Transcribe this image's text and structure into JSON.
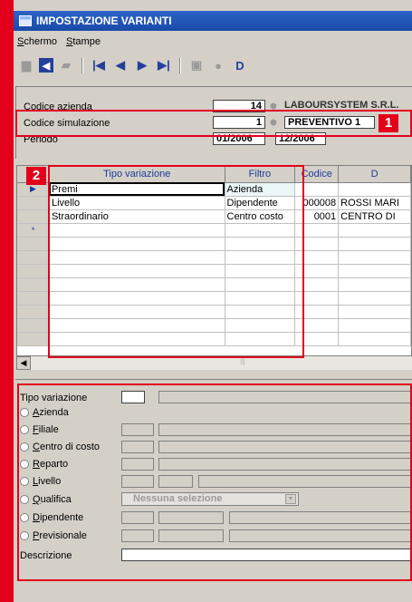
{
  "window": {
    "title": "IMPOSTAZIONE VARIANTI"
  },
  "menu": [
    {
      "label": "Schermo"
    },
    {
      "label": "Stampe"
    }
  ],
  "toolbar": {
    "icons": [
      "save-icon",
      "exit-icon",
      "edit-icon",
      "first-record-icon",
      "previous-record-icon",
      "next-record-icon",
      "last-record-icon",
      "binoculars-icon",
      "search-icon",
      "report-icon"
    ]
  },
  "header": {
    "codice_azienda": {
      "label": "Codice azienda",
      "value": "14",
      "name": "LABOURSYSTEM S.R.L."
    },
    "codice_simulazione": {
      "label": "Codice simulazione",
      "value": "1",
      "name": "PREVENTIVO 1"
    },
    "periodo": {
      "label": "Periodo",
      "from": "01/2006",
      "to": "12/2006"
    }
  },
  "grid": {
    "columns": [
      "Tipo variazione",
      "Filtro",
      "Codice",
      "D"
    ],
    "rows": [
      {
        "tipo": "Premi",
        "filtro": "Azienda",
        "codice": "",
        "desc": ""
      },
      {
        "tipo": "Livello",
        "filtro": "Dipendente",
        "codice": "000008",
        "desc": "ROSSI MARI"
      },
      {
        "tipo": "Straordinario",
        "filtro": "Centro costo",
        "codice": "0001",
        "desc": "CENTRO DI"
      }
    ],
    "new_row_marker": "*",
    "current_row_marker": "▶"
  },
  "form": {
    "tipo_variazione_label": "Tipo variazione",
    "options": [
      "Azienda",
      "Filiale",
      "Centro di costo",
      "Reparto",
      "Livello",
      "Qualifica",
      "Dipendente",
      "Previsionale"
    ],
    "qualifica_combo": "Nessuna selezione",
    "descrizione_label": "Descrizione"
  },
  "callouts": {
    "badge1": "1",
    "badge2": "2"
  },
  "colors": {
    "accent": "#e3001b",
    "titlebar": "#1a4aa8",
    "window_bg": "#d4d0c8"
  }
}
